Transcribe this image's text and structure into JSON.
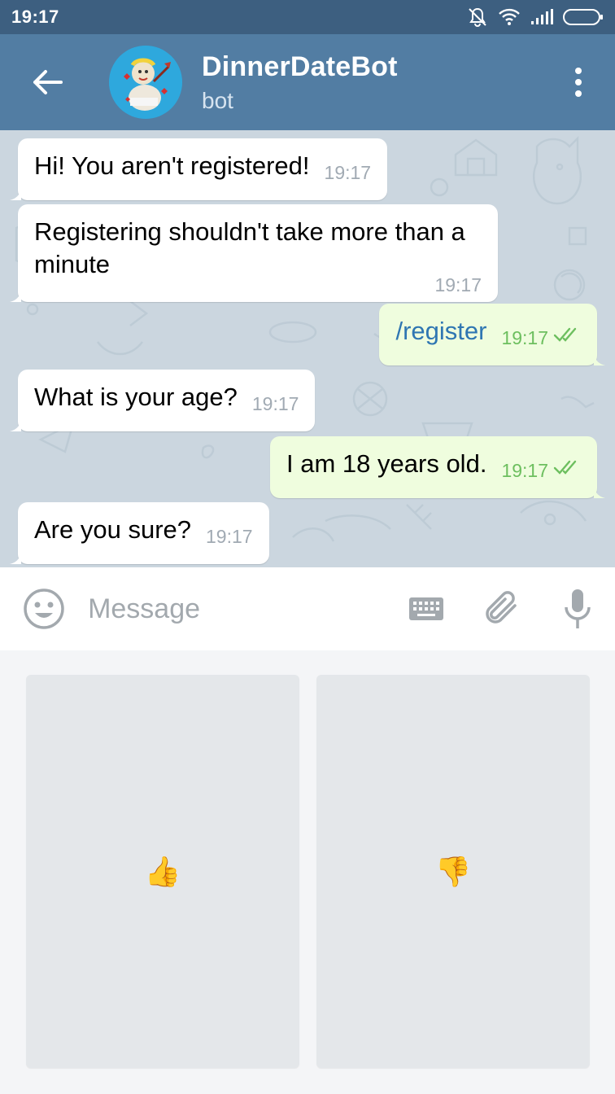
{
  "status_bar": {
    "time": "19:17"
  },
  "header": {
    "title": "DinnerDateBot",
    "subtitle": "bot"
  },
  "messages": [
    {
      "direction": "in",
      "text": "Hi! You aren't registered!",
      "time": "19:17"
    },
    {
      "direction": "in",
      "text": "Registering shouldn't take more than a minute",
      "time": "19:17"
    },
    {
      "direction": "out",
      "text": "/register",
      "time": "19:17",
      "status": "read"
    },
    {
      "direction": "in",
      "text": "What is your age?",
      "time": "19:17"
    },
    {
      "direction": "out",
      "text": "I am 18 years old.",
      "time": "19:17",
      "status": "read"
    },
    {
      "direction": "in",
      "text": "Are you sure?",
      "time": "19:17"
    }
  ],
  "input": {
    "placeholder": "Message",
    "value": ""
  },
  "keyboard": {
    "buttons": [
      "👍",
      "👎"
    ]
  },
  "colors": {
    "header": "#527da3",
    "status_bar": "#3d5f80",
    "outgoing_bubble": "#effdde",
    "command_link": "#2f76b2",
    "read_checks": "#6dbf5f"
  }
}
